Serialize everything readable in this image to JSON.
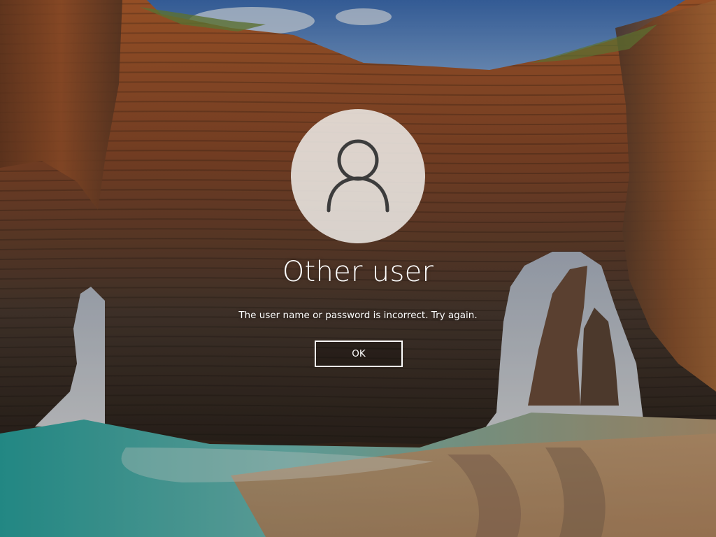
{
  "lock_screen": {
    "user_name": "Other user",
    "error_message": "The user name or password is incorrect. Try again.",
    "ok_label": "OK"
  },
  "icons": {
    "avatar": "user-silhouette-icon"
  },
  "colors": {
    "text": "#ffffff",
    "avatar_bg": "#ece8e4",
    "avatar_glyph": "#3c3c3c"
  }
}
